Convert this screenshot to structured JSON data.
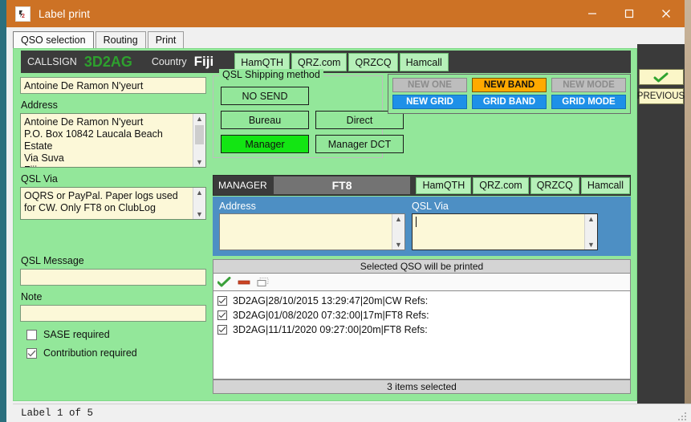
{
  "window": {
    "title": "Label print",
    "icon": "app-logo-icon",
    "minimize": "minimize-icon",
    "maximize": "maximize-icon",
    "close": "close-icon",
    "titlebar_color": "#cd7225"
  },
  "tabs": [
    {
      "label": "QSO selection",
      "selected": false
    },
    {
      "label": "Routing",
      "selected": true
    },
    {
      "label": "Print",
      "selected": false
    }
  ],
  "callsign_bar": {
    "callsign_label": "CALLSIGN",
    "callsign_value": "3D2AG",
    "callsign_color": "#2ea02e",
    "country_label": "Country",
    "country_value": "Fiji",
    "links": [
      "HamQTH",
      "QRZ.com",
      "QRZCQ",
      "Hamcall"
    ]
  },
  "left_panel": {
    "name_value": "Antoine De Ramon N'yeurt",
    "address_label": "Address",
    "address_value": "Antoine De Ramon N'yeurt\nP.O. Box 10842 Laucala Beach\nEstate\nVia Suva\nFiji",
    "qsl_via_label": "QSL Via",
    "qsl_via_value": "OQRS or PayPal. Paper logs used for CW. Only FT8 on ClubLog",
    "qsl_message_label": "QSL Message",
    "qsl_message_value": "",
    "note_label": "Note",
    "note_value": "",
    "sase_label": "SASE required",
    "sase_checked": false,
    "contribution_label": "Contribution required",
    "contribution_checked": true
  },
  "shipping": {
    "legend": "QSL Shipping method",
    "buttons": [
      {
        "label": "NO SEND",
        "active": false
      },
      {
        "label": "Bureau",
        "active": false
      },
      {
        "label": "Direct",
        "active": false
      },
      {
        "label": "Manager",
        "active": true
      },
      {
        "label": "Manager DCT",
        "active": false
      }
    ],
    "active_color": "#13e513"
  },
  "flags": {
    "row1": [
      {
        "label": "NEW ONE",
        "state": "off"
      },
      {
        "label": "NEW BAND",
        "state": "band"
      },
      {
        "label": "NEW MODE",
        "state": "off"
      }
    ],
    "row2": [
      {
        "label": "NEW GRID",
        "state": "grid"
      },
      {
        "label": "GRID BAND",
        "state": "grid"
      },
      {
        "label": "GRID MODE",
        "state": "grid"
      }
    ],
    "colors": {
      "off": "#bdbdbd",
      "band": "#ffaa00",
      "grid": "#1e90e8"
    }
  },
  "manager": {
    "label": "MANAGER",
    "value": "FT8",
    "links": [
      "HamQTH",
      "QRZ.com",
      "QRZCQ",
      "Hamcall"
    ]
  },
  "manager_detail": {
    "address_label": "Address",
    "address_value": "",
    "qsl_via_label": "QSL Via",
    "qsl_via_value": "",
    "panel_color": "#4d8fc4"
  },
  "qso_list": {
    "header": "Selected QSO will be printed",
    "toolbar": [
      "check-all-icon",
      "uncheck-all-icon",
      "invert-selection-icon"
    ],
    "rows": [
      {
        "checked": true,
        "text": "3D2AG|28/10/2015 13:29:47|20m|CW Refs:"
      },
      {
        "checked": true,
        "text": "3D2AG|01/08/2020 07:32:00|17m|FT8 Refs:"
      },
      {
        "checked": true,
        "text": "3D2AG|11/11/2020 09:27:00|20m|FT8 Refs:"
      }
    ],
    "footer": "3 items selected"
  },
  "right_rail": {
    "confirm": "checkmark-icon",
    "previous_label": "PREVIOUS"
  },
  "statusbar": {
    "text": "Label 1 of 5"
  }
}
